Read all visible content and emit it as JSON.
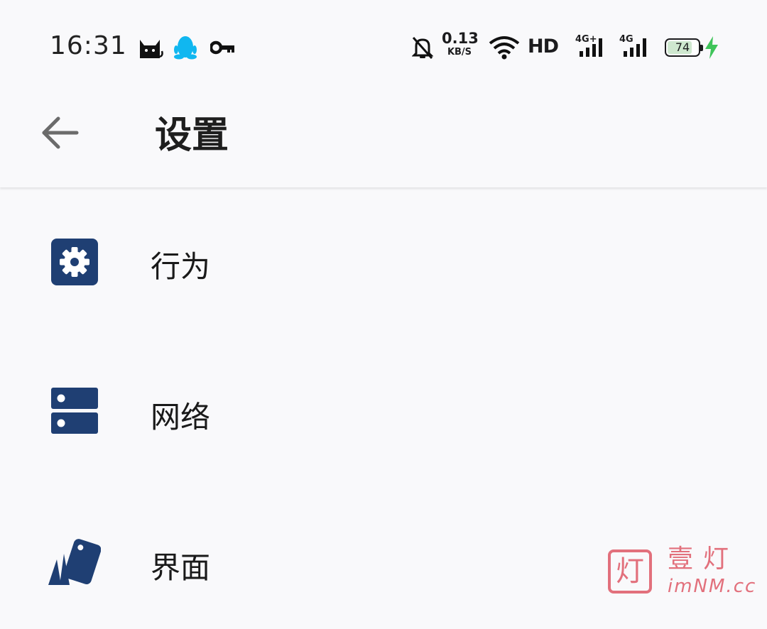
{
  "status_bar": {
    "time": "16:31",
    "net_speed_value": "0.13",
    "net_speed_unit": "KB/S",
    "hd_label": "HD",
    "sim1_label": "4G+",
    "sim2_label": "4G",
    "battery_level": "74",
    "icons": [
      "cat-app-icon",
      "qq-icon",
      "vpn-key-icon",
      "bell-off-icon",
      "wifi-icon",
      "signal-icon",
      "battery-icon",
      "charging-icon"
    ]
  },
  "header": {
    "title": "设置",
    "back_icon": "arrow-left-icon"
  },
  "settings_items": [
    {
      "label": "行为",
      "icon": "gear-icon"
    },
    {
      "label": "网络",
      "icon": "server-icon"
    },
    {
      "label": "界面",
      "icon": "cards-icon"
    }
  ],
  "colors": {
    "accent": "#1f3f73",
    "background": "#f9f9fb",
    "watermark": "#e2707c",
    "charging": "#3fc45a"
  },
  "watermark": {
    "box_char": "灯",
    "text": "壹灯",
    "url": "imNM.cc"
  }
}
